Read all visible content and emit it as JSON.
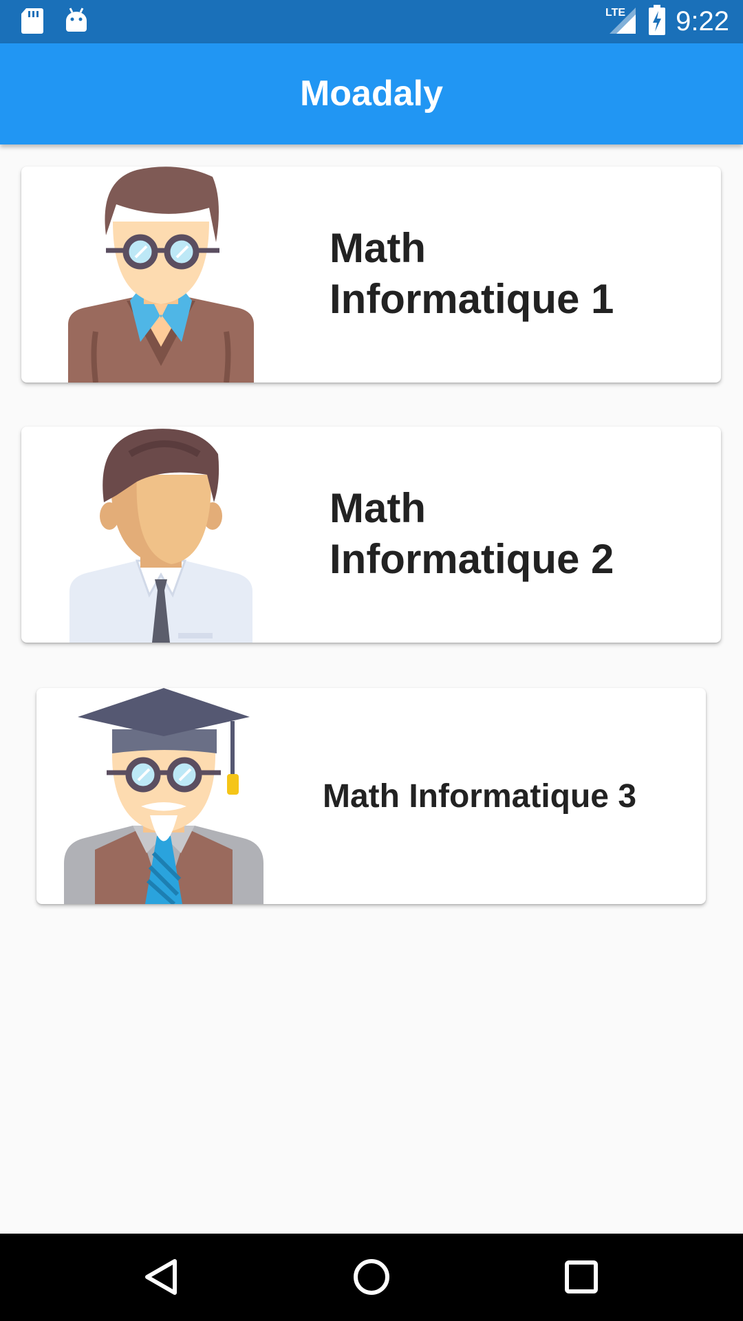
{
  "status_bar": {
    "time": "9:22",
    "network": "LTE",
    "icons": [
      "sd-card-icon",
      "android-icon",
      "lte-signal-icon",
      "battery-charging-icon"
    ]
  },
  "app_bar": {
    "title": "Moadaly"
  },
  "courses": [
    {
      "label": "Math\nInformatique 1",
      "avatar": "teacher-glasses-avatar"
    },
    {
      "label": "Math\nInformatique 2",
      "avatar": "businessman-avatar"
    },
    {
      "label": "Math Informatique 3",
      "avatar": "professor-graduate-avatar"
    }
  ],
  "nav": {
    "icons": [
      "back-triangle-icon",
      "home-circle-icon",
      "recents-square-icon"
    ]
  },
  "colors": {
    "status_bar": "#1a70b9",
    "app_bar": "#2196f3",
    "background": "#fafafa"
  }
}
